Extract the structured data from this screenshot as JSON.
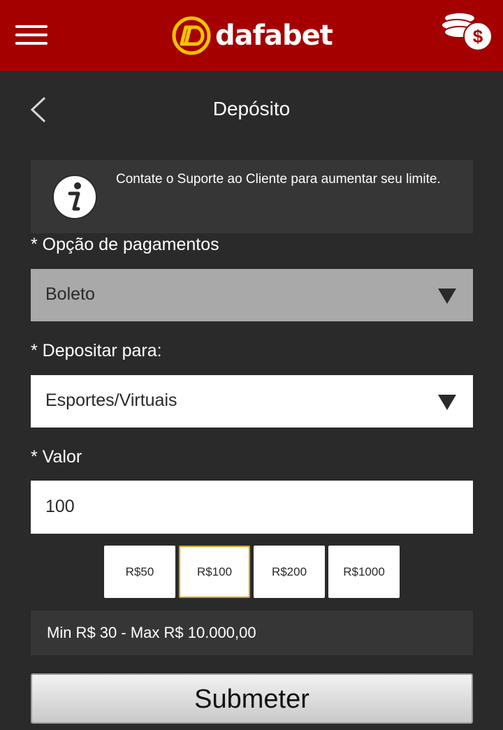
{
  "header": {
    "logo_text": "dafabet",
    "menu_icon": "hamburger-menu-icon",
    "wallet_icon": "coins-dollar-icon",
    "brand_color": "#a50000",
    "logo_accent": "#f5c400"
  },
  "page": {
    "title": "Depósito",
    "back_icon": "chevron-left-icon"
  },
  "info": {
    "icon": "info-icon",
    "text": "Contate o Suporte ao Cliente para aumentar seu limite."
  },
  "form": {
    "payment_label": "* Opção de pagamentos",
    "payment_value": "Boleto",
    "deposit_to_label": "* Depositar para:",
    "deposit_to_value": "Esportes/Virtuais",
    "amount_label": "* Valor",
    "amount_value": "100",
    "quick_amounts": [
      "R$50",
      "R$100",
      "R$200",
      "R$1000"
    ],
    "selected_quick_amount": "R$100",
    "limits_text": "Min R$ 30 - Max R$ 10.000,00",
    "submit_label": "Submeter"
  }
}
